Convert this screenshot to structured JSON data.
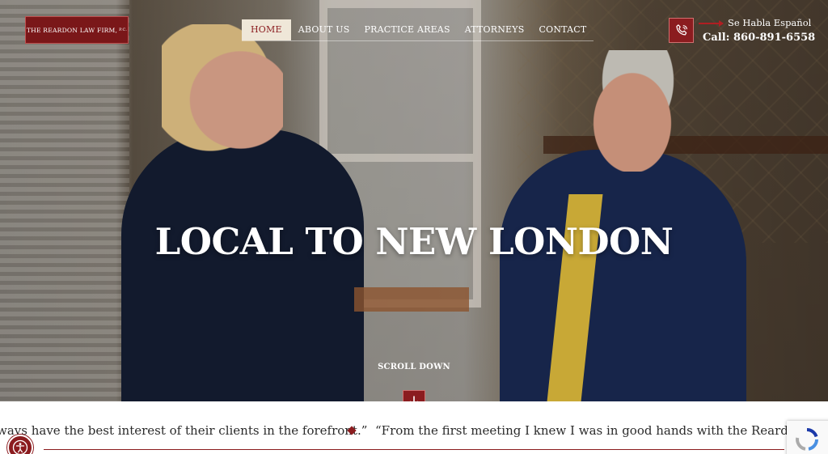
{
  "header": {
    "logo_text": "THE REARDON LAW FIRM,",
    "logo_suffix": "P.C.",
    "nav": [
      {
        "label": "HOME"
      },
      {
        "label": "ABOUT US"
      },
      {
        "label": "PRACTICE AREAS"
      },
      {
        "label": "ATTORNEYS"
      },
      {
        "label": "CONTACT"
      }
    ],
    "spanish_label": "Se Habla Español",
    "phone_label": "Call: 860-891-6558",
    "phone_icon": "phone-icon"
  },
  "hero": {
    "headline": "LOCAL TO NEW LONDON",
    "scroll_label": "SCROLL DOWN",
    "scroll_icon": "arrow-down-icon"
  },
  "testimonials": {
    "quote_a": "ways have the best interest of their clients in the forefront.”",
    "quote_b": "“From the first meeting I knew I was in good hands with the Reardon Law Fi"
  },
  "colors": {
    "brand_red": "#8b1c1f",
    "nav_active_bg": "#efe7d8"
  },
  "widgets": {
    "accessibility_icon": "accessibility-icon",
    "recaptcha_icon": "recaptcha-icon"
  }
}
